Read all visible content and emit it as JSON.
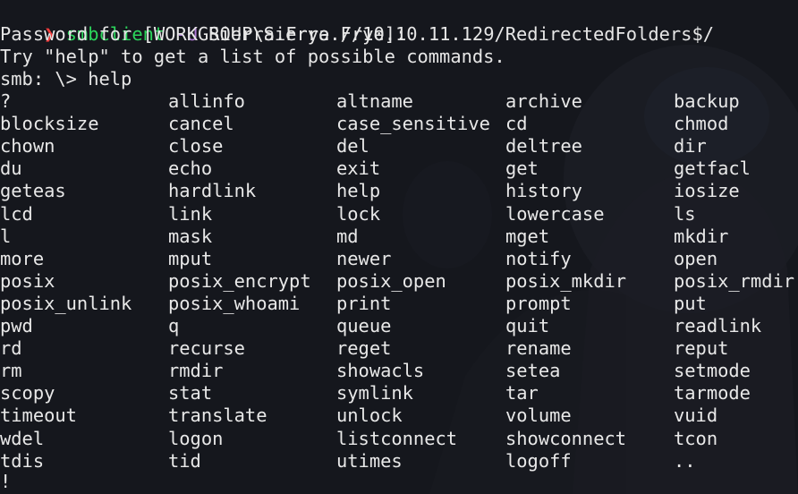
{
  "terminal": {
    "prompt_symbol": "❯",
    "command_name": "smbclient",
    "command_flag": "-U",
    "command_args": "Sierra.Frye //10.10.11.129/RedirectedFolders$/",
    "password_line": "Password for [WORKGROUP\\Sierra.Frye]:",
    "hint_line": "Try \"help\" to get a list of possible commands.",
    "smb_prompt": "smb: \\> help",
    "final_line": "!"
  },
  "help_rows": [
    [
      "?",
      "allinfo",
      "altname",
      "archive",
      "backup"
    ],
    [
      "blocksize",
      "cancel",
      "case_sensitive",
      "cd",
      "chmod"
    ],
    [
      "chown",
      "close",
      "del",
      "deltree",
      "dir"
    ],
    [
      "du",
      "echo",
      "exit",
      "get",
      "getfacl"
    ],
    [
      "geteas",
      "hardlink",
      "help",
      "history",
      "iosize"
    ],
    [
      "lcd",
      "link",
      "lock",
      "lowercase",
      "ls"
    ],
    [
      "l",
      "mask",
      "md",
      "mget",
      "mkdir"
    ],
    [
      "more",
      "mput",
      "newer",
      "notify",
      "open"
    ],
    [
      "posix",
      "posix_encrypt",
      "posix_open",
      "posix_mkdir",
      "posix_rmdir"
    ],
    [
      "posix_unlink",
      "posix_whoami",
      "print",
      "prompt",
      "put"
    ],
    [
      "pwd",
      "q",
      "queue",
      "quit",
      "readlink"
    ],
    [
      "rd",
      "recurse",
      "reget",
      "rename",
      "reput"
    ],
    [
      "rm",
      "rmdir",
      "showacls",
      "setea",
      "setmode"
    ],
    [
      "scopy",
      "stat",
      "symlink",
      "tar",
      "tarmode"
    ],
    [
      "timeout",
      "translate",
      "unlock",
      "volume",
      "vuid"
    ],
    [
      "wdel",
      "logon",
      "listconnect",
      "showconnect",
      "tcon"
    ],
    [
      "tdis",
      "tid",
      "utimes",
      "logoff",
      ".."
    ]
  ],
  "colors": {
    "background": "#15171d",
    "text": "#e6e6e6",
    "prompt_arrow": "#ef3b3b",
    "command": "#2bd45b",
    "flag": "#b07ad6"
  }
}
